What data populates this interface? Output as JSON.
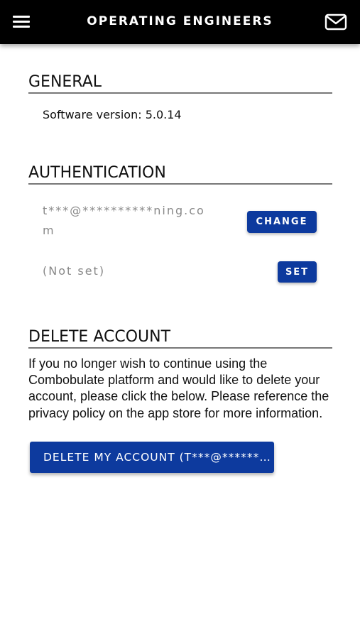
{
  "header": {
    "title": "OPERATING ENGINEERS",
    "menu_icon": "hamburger-menu-icon",
    "mail_icon": "mail-icon",
    "background": "#000000"
  },
  "general": {
    "heading": "GENERAL",
    "software_version": "Software version: 5.0.14"
  },
  "authentication": {
    "heading": "AUTHENTICATION",
    "email_line1": "t***@**********ning.co",
    "email_line2": "m",
    "change_label": "CHANGE",
    "phone_value": "(Not set)",
    "set_label": "SET"
  },
  "delete_account": {
    "heading": "DELETE ACCOUNT",
    "description": "If you no longer wish to continue using the Combobulate platform and would like to delete your account, please click the below. Please reference the privacy policy on the app store for more information.",
    "button_label": "DELETE MY ACCOUNT (T***@**********NING.COM)"
  },
  "colors": {
    "button_blue": "#0d3a9e",
    "masked_text": "#888888"
  }
}
